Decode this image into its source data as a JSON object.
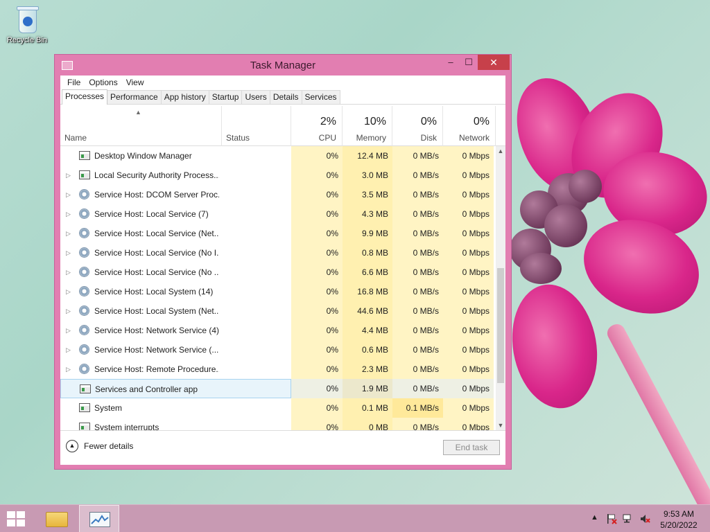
{
  "desktop": {
    "icons": [
      {
        "label": "Recycle Bin",
        "icon": "recycle-bin-icon"
      }
    ]
  },
  "window": {
    "title": "Task Manager",
    "controls": {
      "minimize": "–",
      "maximize": "☐",
      "close": "✕"
    },
    "menu": [
      "File",
      "Options",
      "View"
    ],
    "tabs": [
      "Processes",
      "Performance",
      "App history",
      "Startup",
      "Users",
      "Details",
      "Services"
    ],
    "active_tab": "Processes"
  },
  "columns": {
    "name": "Name",
    "status": "Status",
    "cpu": {
      "percent": "2%",
      "label": "CPU"
    },
    "memory": {
      "percent": "10%",
      "label": "Memory"
    },
    "disk": {
      "percent": "0%",
      "label": "Disk"
    },
    "network": {
      "percent": "0%",
      "label": "Network"
    }
  },
  "processes": [
    {
      "name": "Desktop Window Manager",
      "expandable": false,
      "icon": "window-icon",
      "cpu": "0%",
      "memory": "12.4 MB",
      "disk": "0 MB/s",
      "network": "0 Mbps"
    },
    {
      "name": "Local Security Authority Process...",
      "expandable": true,
      "icon": "window-icon",
      "cpu": "0%",
      "memory": "3.0 MB",
      "disk": "0 MB/s",
      "network": "0 Mbps"
    },
    {
      "name": "Service Host: DCOM Server Proc...",
      "expandable": true,
      "icon": "gear-icon",
      "cpu": "0%",
      "memory": "3.5 MB",
      "disk": "0 MB/s",
      "network": "0 Mbps"
    },
    {
      "name": "Service Host: Local Service (7)",
      "expandable": true,
      "icon": "gear-icon",
      "cpu": "0%",
      "memory": "4.3 MB",
      "disk": "0 MB/s",
      "network": "0 Mbps"
    },
    {
      "name": "Service Host: Local Service (Net...",
      "expandable": true,
      "icon": "gear-icon",
      "cpu": "0%",
      "memory": "9.9 MB",
      "disk": "0 MB/s",
      "network": "0 Mbps"
    },
    {
      "name": "Service Host: Local Service (No I...",
      "expandable": true,
      "icon": "gear-icon",
      "cpu": "0%",
      "memory": "0.8 MB",
      "disk": "0 MB/s",
      "network": "0 Mbps"
    },
    {
      "name": "Service Host: Local Service (No ...",
      "expandable": true,
      "icon": "gear-icon",
      "cpu": "0%",
      "memory": "6.6 MB",
      "disk": "0 MB/s",
      "network": "0 Mbps"
    },
    {
      "name": "Service Host: Local System (14)",
      "expandable": true,
      "icon": "gear-icon",
      "cpu": "0%",
      "memory": "16.8 MB",
      "disk": "0 MB/s",
      "network": "0 Mbps"
    },
    {
      "name": "Service Host: Local System (Net...",
      "expandable": true,
      "icon": "gear-icon",
      "cpu": "0%",
      "memory": "44.6 MB",
      "disk": "0 MB/s",
      "network": "0 Mbps"
    },
    {
      "name": "Service Host: Network Service (4)",
      "expandable": true,
      "icon": "gear-icon",
      "cpu": "0%",
      "memory": "4.4 MB",
      "disk": "0 MB/s",
      "network": "0 Mbps"
    },
    {
      "name": "Service Host: Network Service (...",
      "expandable": true,
      "icon": "gear-icon",
      "cpu": "0%",
      "memory": "0.6 MB",
      "disk": "0 MB/s",
      "network": "0 Mbps"
    },
    {
      "name": "Service Host: Remote Procedure...",
      "expandable": true,
      "icon": "gear-icon",
      "cpu": "0%",
      "memory": "2.3 MB",
      "disk": "0 MB/s",
      "network": "0 Mbps"
    },
    {
      "name": "Services and Controller app",
      "expandable": false,
      "icon": "window-icon",
      "cpu": "0%",
      "memory": "1.9 MB",
      "disk": "0 MB/s",
      "network": "0 Mbps",
      "selected": true
    },
    {
      "name": "System",
      "expandable": false,
      "icon": "window-icon",
      "cpu": "0%",
      "memory": "0.1 MB",
      "disk": "0.1 MB/s",
      "network": "0 Mbps",
      "highlight": true
    },
    {
      "name": "System interrupts",
      "expandable": false,
      "icon": "window-icon",
      "cpu": "0%",
      "memory": "0 MB",
      "disk": "0 MB/s",
      "network": "0 Mbps"
    }
  ],
  "footer": {
    "fewer_details": "Fewer details",
    "end_task": "End task"
  },
  "taskbar": {
    "clock_time": "9:53 AM",
    "clock_date": "5/20/2022",
    "tray_icons": [
      "chevron-up-icon",
      "action-center-flag-icon",
      "network-icon",
      "volume-muted-icon"
    ]
  },
  "colors": {
    "window_frame": "#e27eb1",
    "close_button": "#c7404a",
    "heat_light": "#fff4c4",
    "heat_medium": "#fff0b0",
    "selection": "#e8f4fb",
    "taskbar": "#c89ab3"
  }
}
